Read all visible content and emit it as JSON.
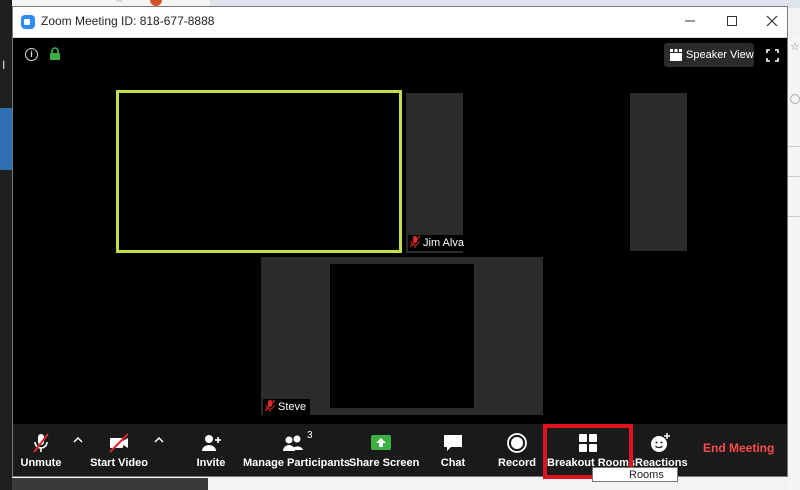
{
  "window": {
    "title": "Zoom Meeting ID: 818-677-8888"
  },
  "top_bar": {
    "speaker_view_label": "Speaker View"
  },
  "participants": [
    {
      "name": "Jim Alva"
    },
    {
      "name": "Steve"
    }
  ],
  "toolbar": {
    "unmute_label": "Unmute",
    "start_video_label": "Start Video",
    "invite_label": "Invite",
    "manage_participants_label": "Manage Participants",
    "participant_count": "3",
    "share_screen_label": "Share Screen",
    "chat_label": "Chat",
    "record_label": "Record",
    "breakout_rooms_label": "Breakout Rooms",
    "reactions_label": "Reactions",
    "end_meeting_label": "End Meeting"
  },
  "tooltip": {
    "text": "Rooms"
  },
  "background": {
    "left_letter": "I"
  },
  "colors": {
    "active_speaker_border": "#c9dc4a",
    "end_meeting": "#ff4a4a",
    "share_screen": "#3cb043",
    "highlight": "#e1121f",
    "zoom_blue": "#2d8cff"
  }
}
